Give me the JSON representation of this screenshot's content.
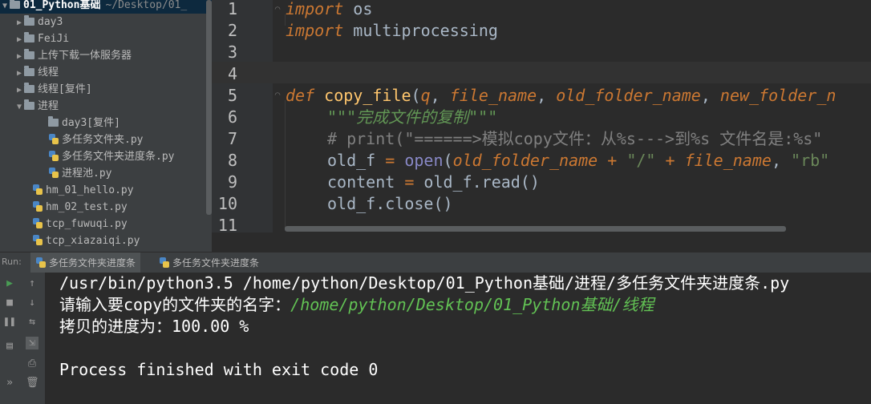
{
  "project_tree": {
    "root": {
      "name": "01_Python基础",
      "path": "~/Desktop/01_"
    },
    "items": [
      {
        "label": "day3",
        "type": "folder"
      },
      {
        "label": "FeiJi",
        "type": "folder"
      },
      {
        "label": "上传下载一体服务器",
        "type": "folder"
      },
      {
        "label": "线程",
        "type": "folder"
      },
      {
        "label": "线程[复件]",
        "type": "folder"
      },
      {
        "label": "进程",
        "type": "folder"
      },
      {
        "label": "day3[复件]",
        "type": "folder"
      },
      {
        "label": "多任务文件夹.py",
        "type": "python-file"
      },
      {
        "label": "多任务文件夹进度条.py",
        "type": "python-file"
      },
      {
        "label": "进程池.py",
        "type": "python-file"
      },
      {
        "label": "hm_01_hello.py",
        "type": "python-file"
      },
      {
        "label": "hm_02_test.py",
        "type": "python-file"
      },
      {
        "label": "tcp_fuwuqi.py",
        "type": "python-file"
      },
      {
        "label": "tcp_xiazaiqi.py",
        "type": "python-file"
      }
    ]
  },
  "editor": {
    "line_numbers": [
      "1",
      "2",
      "3",
      "4",
      "5",
      "6",
      "7",
      "8",
      "9",
      "10",
      "11"
    ],
    "code": {
      "l1_kw": "import",
      "l1_rest": " os",
      "l2_kw": "import",
      "l2_rest": " multiprocessing",
      "l5_kw": "def",
      "l5_fn": "copy_file",
      "l5_open": "(",
      "l5_p1": "q",
      "l5_sep1": ", ",
      "l5_p2": "file_name",
      "l5_sep2": ", ",
      "l5_p3": "old_folder_name",
      "l5_sep3": ", ",
      "l5_p4": "new_folder_n",
      "l6_doc": "\"\"\"完成文件的复制\"\"\"",
      "l7_cmt": "# print(\"======>模拟copy文件：从%s--->到%s 文件名是:%s\"",
      "l8_a": "old_f ",
      "l8_eq": "=",
      "l8_sp": " ",
      "l8_open": "open",
      "l8_b": "(",
      "l8_p1": "old_folder_name",
      "l8_plus1": " + ",
      "l8_s1": "\"/\"",
      "l8_plus2": " + ",
      "l8_p2": "file_name",
      "l8_c": ", ",
      "l8_s2": "\"rb\"",
      "l9_a": "content ",
      "l9_eq": "=",
      "l9_rest": " old_f.read()",
      "l10": "old_f.close()"
    }
  },
  "run_panel": {
    "label": "Run:",
    "tabs": [
      "多任务文件夹进度条",
      "多任务文件夹进度条"
    ],
    "console": {
      "line1": "/usr/bin/python3.5 /home/python/Desktop/01_Python基础/进程/多任务文件夹进度条.py",
      "line2_prompt": "请输入要copy的文件夹的名字：",
      "line2_input": "/home/python/Desktop/01_Python基础/线程",
      "line3": "拷贝的进度为：100.00 %",
      "line5": "Process finished with exit code 0"
    }
  },
  "colors": {
    "keyword": "#cc7832",
    "function": "#ffc66d",
    "string": "#6a8759",
    "comment": "#808080",
    "console_input": "#62c254",
    "run_icon": "#499c54"
  }
}
